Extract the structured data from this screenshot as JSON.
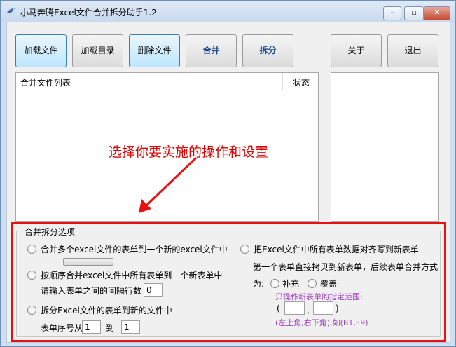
{
  "window": {
    "title": "小马奔腾Excel文件合并拆分助手1.2",
    "controls": [
      "–",
      "▫",
      "✕"
    ]
  },
  "toolbar": {
    "load_files": "加载文件",
    "load_dir": "加载目录",
    "delete_files": "删除文件",
    "merge": "合并",
    "split": "拆分",
    "about": "关于",
    "exit": "退出"
  },
  "file_list": {
    "col_name": "合并文件列表",
    "col_status": "状态"
  },
  "annotation": {
    "text": "选择你要实施的操作和设置",
    "color": "#e00000"
  },
  "options": {
    "group_title": "合并拆分选项",
    "opt1": "合并多个excel文件的表单到一个新的excel文件中",
    "opt2": "按顺序合并excel文件中所有表单到一个新表单中",
    "opt2_gap_label": "请输入表单之间的间隔行数",
    "opt2_gap_value": "0",
    "opt3": "拆分Excel文件的表单到新的文件中",
    "opt3_from_label": "表单序号从",
    "opt3_from_value": "1",
    "opt3_to_label": "到",
    "opt3_to_value": "1",
    "opt4": "把Excel文件中所有表单数据对齐写到新表单",
    "opt4_desc": "第一个表单直接拷贝到新表单，后续表单合并方式",
    "opt4_mode_label": "为:",
    "mode_supplement": "补充",
    "mode_overwrite": "覆盖",
    "range_hint": "只操作新表单的指定范围:",
    "range_open": "(",
    "range_comma": ",",
    "range_close": ")",
    "range_example": "(左上角,右下角),如(B1,F9)"
  }
}
